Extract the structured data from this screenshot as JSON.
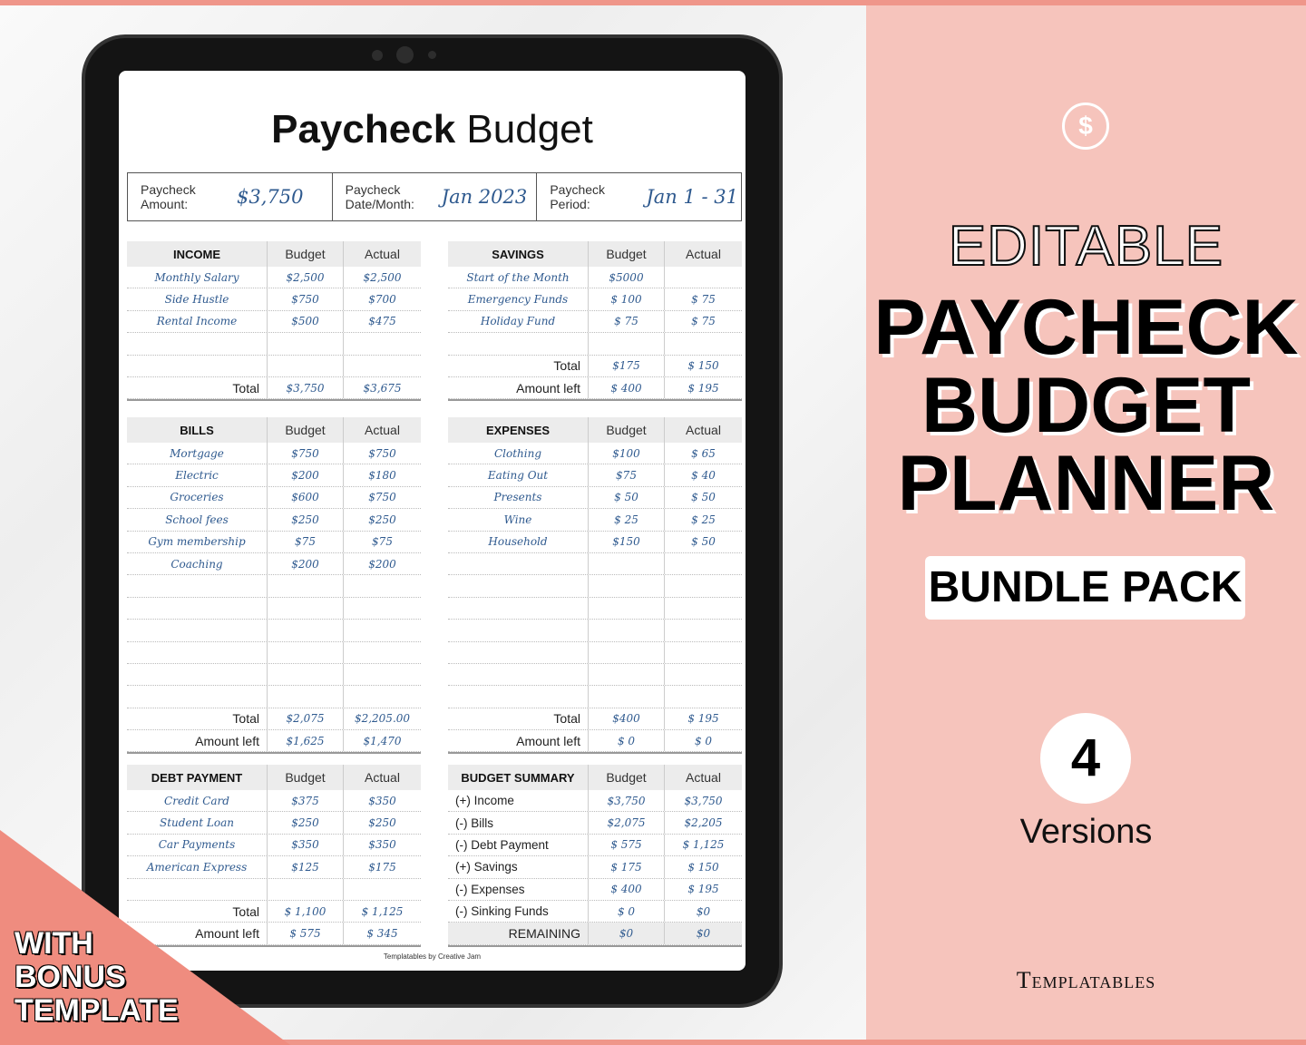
{
  "colors": {
    "pink_panel": "#f6c4bc",
    "salmon": "#ef8c7f",
    "handwriting": "#2f5a8f",
    "header_gray": "#ececec"
  },
  "sheet": {
    "title_bold": "Paycheck",
    "title_rest": "Budget",
    "info": [
      {
        "label": "Paycheck Amount:",
        "value": "$3,750"
      },
      {
        "label": "Paycheck Date/Month:",
        "value": "Jan 2023"
      },
      {
        "label": "Paycheck Period:",
        "value": "Jan 1 - 31"
      }
    ],
    "footer": "Templatables by Creative Jam"
  },
  "tables": {
    "income": {
      "headers": [
        "INCOME",
        "Budget",
        "Actual"
      ],
      "rows": [
        [
          "Monthly Salary",
          "$2,500",
          "$2,500"
        ],
        [
          "Side Hustle",
          "$750",
          "$700"
        ],
        [
          "Rental Income",
          "$500",
          "$475"
        ],
        [
          "",
          "",
          ""
        ],
        [
          "",
          "",
          ""
        ]
      ],
      "totals": [
        [
          "Total",
          "$3,750",
          "$3,675"
        ]
      ]
    },
    "savings": {
      "headers": [
        "SAVINGS",
        "Budget",
        "Actual"
      ],
      "rows": [
        [
          "Start of the Month",
          "$5000",
          ""
        ],
        [
          "Emergency Funds",
          "$ 100",
          "$ 75"
        ],
        [
          "Holiday Fund",
          "$ 75",
          "$ 75"
        ],
        [
          "",
          "",
          ""
        ]
      ],
      "totals": [
        [
          "Total",
          "$175",
          "$ 150"
        ],
        [
          "Amount left",
          "$ 400",
          "$ 195"
        ]
      ]
    },
    "bills": {
      "headers": [
        "BILLS",
        "Budget",
        "Actual"
      ],
      "rows": [
        [
          "Mortgage",
          "$750",
          "$750"
        ],
        [
          "Electric",
          "$200",
          "$180"
        ],
        [
          "Groceries",
          "$600",
          "$750"
        ],
        [
          "School fees",
          "$250",
          "$250"
        ],
        [
          "Gym membership",
          "$75",
          "$75"
        ],
        [
          "Coaching",
          "$200",
          "$200"
        ],
        [
          "",
          "",
          ""
        ],
        [
          "",
          "",
          ""
        ],
        [
          "",
          "",
          ""
        ],
        [
          "",
          "",
          ""
        ],
        [
          "",
          "",
          ""
        ],
        [
          "",
          "",
          ""
        ]
      ],
      "totals": [
        [
          "Total",
          "$2,075",
          "$2,205.00"
        ],
        [
          "Amount left",
          "$1,625",
          "$1,470"
        ]
      ]
    },
    "expenses": {
      "headers": [
        "EXPENSES",
        "Budget",
        "Actual"
      ],
      "rows": [
        [
          "Clothing",
          "$100",
          "$ 65"
        ],
        [
          "Eating Out",
          "$75",
          "$ 40"
        ],
        [
          "Presents",
          "$ 50",
          "$ 50"
        ],
        [
          "Wine",
          "$ 25",
          "$ 25"
        ],
        [
          "Household",
          "$150",
          "$ 50"
        ],
        [
          "",
          "",
          ""
        ],
        [
          "",
          "",
          ""
        ],
        [
          "",
          "",
          ""
        ],
        [
          "",
          "",
          ""
        ],
        [
          "",
          "",
          ""
        ],
        [
          "",
          "",
          ""
        ],
        [
          "",
          "",
          ""
        ]
      ],
      "totals": [
        [
          "Total",
          "$400",
          "$ 195"
        ],
        [
          "Amount left",
          "$ 0",
          "$ 0"
        ]
      ]
    },
    "debt": {
      "headers": [
        "DEBT PAYMENT",
        "Budget",
        "Actual"
      ],
      "rows": [
        [
          "Credit Card",
          "$375",
          "$350"
        ],
        [
          "Student Loan",
          "$250",
          "$250"
        ],
        [
          "Car Payments",
          "$350",
          "$350"
        ],
        [
          "American Express",
          "$125",
          "$175"
        ],
        [
          "",
          "",
          ""
        ]
      ],
      "totals": [
        [
          "Total",
          "$ 1,100",
          "$ 1,125"
        ],
        [
          "Amount left",
          "$ 575",
          "$ 345"
        ]
      ]
    },
    "summary": {
      "headers": [
        "BUDGET SUMMARY",
        "Budget",
        "Actual"
      ],
      "items": [
        [
          "(+) Income",
          "$3,750",
          "$3,750"
        ],
        [
          "(-) Bills",
          "$2,075",
          "$2,205"
        ],
        [
          "(-) Debt Payment",
          "$ 575",
          "$ 1,125"
        ],
        [
          "(+) Savings",
          "$ 175",
          "$ 150"
        ],
        [
          "(-) Expenses",
          "$ 400",
          "$ 195"
        ],
        [
          "(-) Sinking Funds",
          "$ 0",
          "$0"
        ]
      ],
      "remaining": [
        "REMAINING",
        "$0",
        "$0"
      ]
    }
  },
  "promo": {
    "icon": "dollar-circle-icon",
    "editable": "EDITABLE",
    "headline": [
      "PAYCHECK",
      "BUDGET",
      "PLANNER"
    ],
    "bundle": "BUNDLE PACK",
    "versions_count": "4",
    "versions_label": "Versions",
    "brand": "Templatables",
    "bonus": [
      "WITH",
      "BONUS",
      "TEMPLATE"
    ]
  }
}
